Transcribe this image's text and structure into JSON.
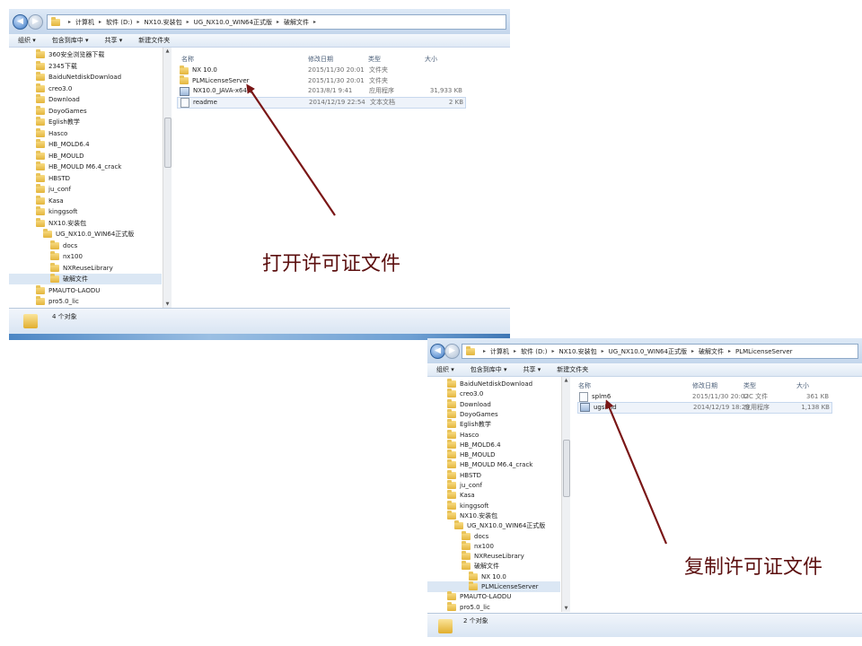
{
  "window1": {
    "breadcrumb": [
      "计算机",
      "软件 (D:)",
      "NX10.安装包",
      "UG_NX10.0_WIN64正式版",
      "破解文件"
    ],
    "toolbar": [
      "组织 ▾",
      "包含到库中 ▾",
      "共享 ▾",
      "新建文件夹"
    ],
    "tree": [
      "360安全浏览器下载",
      "2345下载",
      "BaiduNetdiskDownload",
      "creo3.0",
      "Download",
      "DoyoGames",
      "Eglish教学",
      "Hasco",
      "HB_MOLD6.4",
      "HB_MOULD",
      "HB_MOULD M6.4_crack",
      "HBSTD",
      "ju_conf",
      "Kasa",
      "kinggsoft",
      "NX10.安装包",
      "UG_NX10.0_WIN64正式版",
      "docs",
      "nx100",
      "NXReuseLibrary",
      "破解文件",
      "PMAUTO-LAODU",
      "pro5.0_lic"
    ],
    "columns": [
      "名称",
      "修改日期",
      "类型",
      "大小"
    ],
    "files": [
      {
        "name": "NX 10.0",
        "date": "2015/11/30 20:01",
        "type": "文件夹",
        "size": ""
      },
      {
        "name": "PLMLicenseServer",
        "date": "2015/11/30 20:01",
        "type": "文件夹",
        "size": ""
      },
      {
        "name": "NX10.0_JAVA-x64威",
        "date": "2013/8/1 9:41",
        "type": "应用程序",
        "size": "31,933 KB"
      },
      {
        "name": "readme",
        "date": "2014/12/19 22:54",
        "type": "文本文档",
        "size": "2 KB"
      }
    ],
    "status": "4 个对象"
  },
  "window2": {
    "breadcrumb": [
      "计算机",
      "软件 (D:)",
      "NX10.安装包",
      "UG_NX10.0_WIN64正式版",
      "破解文件",
      "PLMLicenseServer"
    ],
    "toolbar": [
      "组织 ▾",
      "包含到库中 ▾",
      "共享 ▾",
      "新建文件夹"
    ],
    "tree": [
      "BaiduNetdiskDownload",
      "creo3.0",
      "Download",
      "DoyoGames",
      "Eglish教学",
      "Hasco",
      "HB_MOLD6.4",
      "HB_MOULD",
      "HB_MOULD M6.4_crack",
      "HBSTD",
      "ju_conf",
      "Kasa",
      "kinggsoft",
      "NX10.安装包",
      "UG_NX10.0_WIN64正式版",
      "docs",
      "nx100",
      "NXReuseLibrary",
      "破解文件",
      "NX 10.0",
      "PLMLicenseServer",
      "PMAUTO-LAODU",
      "pro5.0_lic"
    ],
    "columns": [
      "名称",
      "修改日期",
      "类型",
      "大小"
    ],
    "files": [
      {
        "name": "splm6",
        "date": "2015/11/30 20:02",
        "type": "LIC 文件",
        "size": "361 KB"
      },
      {
        "name": "ugslmd",
        "date": "2014/12/19 18:29",
        "type": "应用程序",
        "size": "1,138 KB"
      }
    ],
    "status": "2 个对象"
  },
  "captions": {
    "open": "打开许可证文件",
    "copy": "复制许可证文件"
  },
  "colors": {
    "arrow": "#7a1616",
    "caption": "#5c1010"
  }
}
